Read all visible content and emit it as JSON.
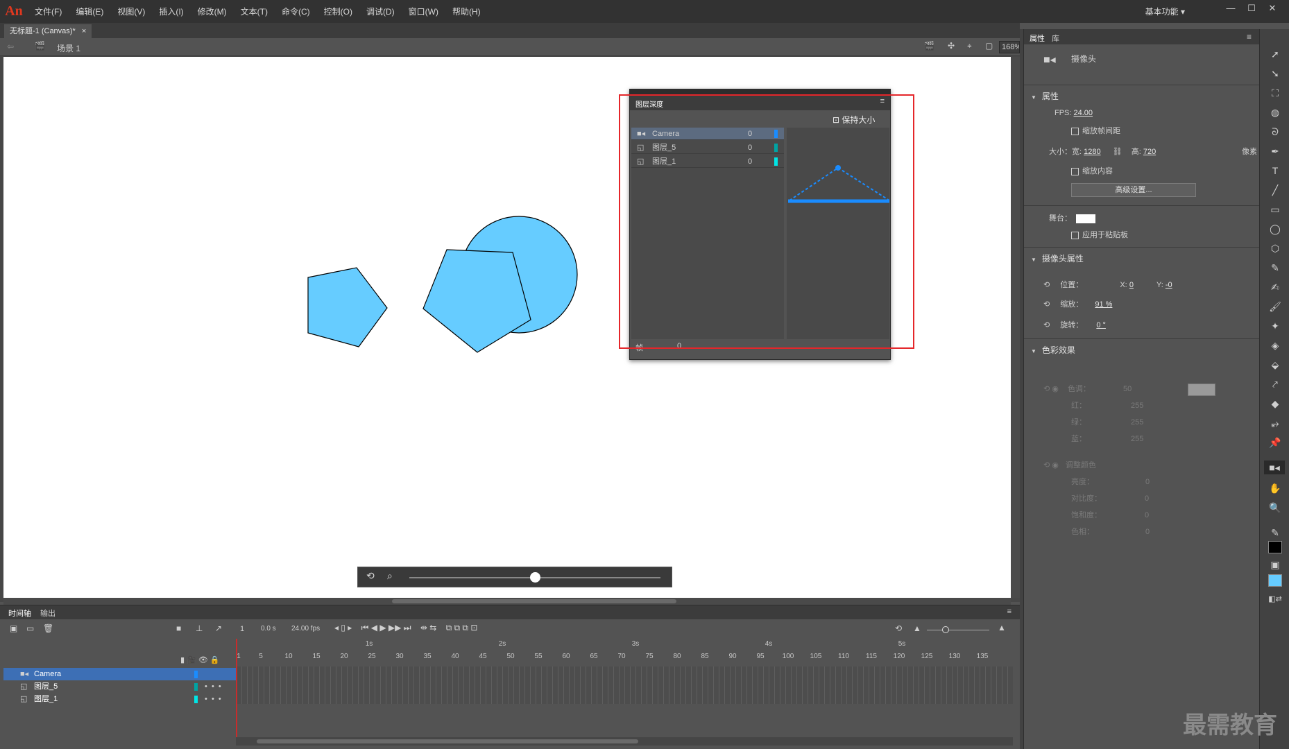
{
  "app": {
    "logo": "An",
    "workspace": "基本功能"
  },
  "menu": [
    "文件(F)",
    "编辑(E)",
    "视图(V)",
    "插入(I)",
    "修改(M)",
    "文本(T)",
    "命令(C)",
    "控制(O)",
    "调试(D)",
    "窗口(W)",
    "帮助(H)"
  ],
  "document_tab": {
    "title": "无标题-1 (Canvas)*",
    "close": "×"
  },
  "edit_bar": {
    "scene": "场景 1",
    "zoom": "168%"
  },
  "depth_panel": {
    "title": "图层深度",
    "keep_size": "保持大小",
    "layers": [
      {
        "name": "Camera",
        "depth": "0",
        "color": "#1a8cff"
      },
      {
        "name": "图层_5",
        "depth": "0",
        "color": "#00a3a3"
      },
      {
        "name": "图层_1",
        "depth": "0",
        "color": "#00e5e5"
      }
    ],
    "frame_label": "帧",
    "frame_value": "0"
  },
  "timeline": {
    "tabs": [
      "时间轴",
      "输出"
    ],
    "frame": "1",
    "time": "0.0 s",
    "fps": "24.00 fps",
    "seconds": [
      "1s",
      "2s",
      "3s",
      "4s",
      "5s"
    ],
    "frame_numbers": [
      "1",
      "5",
      "10",
      "15",
      "20",
      "25",
      "30",
      "35",
      "40",
      "45",
      "50",
      "55",
      "60",
      "65",
      "70",
      "75",
      "80",
      "85",
      "90",
      "95",
      "100",
      "105",
      "110",
      "115",
      "120",
      "125",
      "130",
      "135"
    ],
    "layers": [
      {
        "name": "Camera",
        "color": "#1a8cff"
      },
      {
        "name": "图层_5",
        "color": "#00a3a3"
      },
      {
        "name": "图层_1",
        "color": "#00e5e5"
      }
    ]
  },
  "properties": {
    "tabs": [
      "属性",
      "库"
    ],
    "object": "摄像头",
    "section_props": "属性",
    "fps_label": "FPS:",
    "fps_value": "24.00",
    "scale_spans": "缩放帧间距",
    "size_label": "大小：",
    "width_label": "宽:",
    "width_value": "1280",
    "height_label": "高:",
    "height_value": "720",
    "unit": "像素",
    "scale_content": "缩放内容",
    "advanced": "高级设置...",
    "stage_label": "舞台：",
    "apply_pasteboard": "应用于粘贴板",
    "section_camera": "摄像头属性",
    "position_label": "位置：",
    "x_label": "X:",
    "x_value": "0",
    "y_label": "Y:",
    "y_value": "-0",
    "zoom_label": "缩放：",
    "zoom_value": "91 %",
    "rotate_label": "旋转：",
    "rotate_value": "0 °",
    "section_color": "色彩效果",
    "tint_label": "色调：",
    "tint_value": "50",
    "red_label": "红：",
    "red_value": "255",
    "green_label": "绿：",
    "green_value": "255",
    "blue_label": "蓝：",
    "blue_value": "255",
    "adjust_label": "调整颜色",
    "brightness_label": "亮度：",
    "brightness_value": "0",
    "contrast_label": "对比度：",
    "contrast_value": "0",
    "saturation_label": "饱和度：",
    "saturation_value": "0",
    "hue_label": "色相：",
    "hue_value": "0"
  },
  "watermark": "最需教育",
  "colors": {
    "shape_fill": "#66ccff",
    "accent": "#1a8cff",
    "highlight": "#e5262a"
  }
}
